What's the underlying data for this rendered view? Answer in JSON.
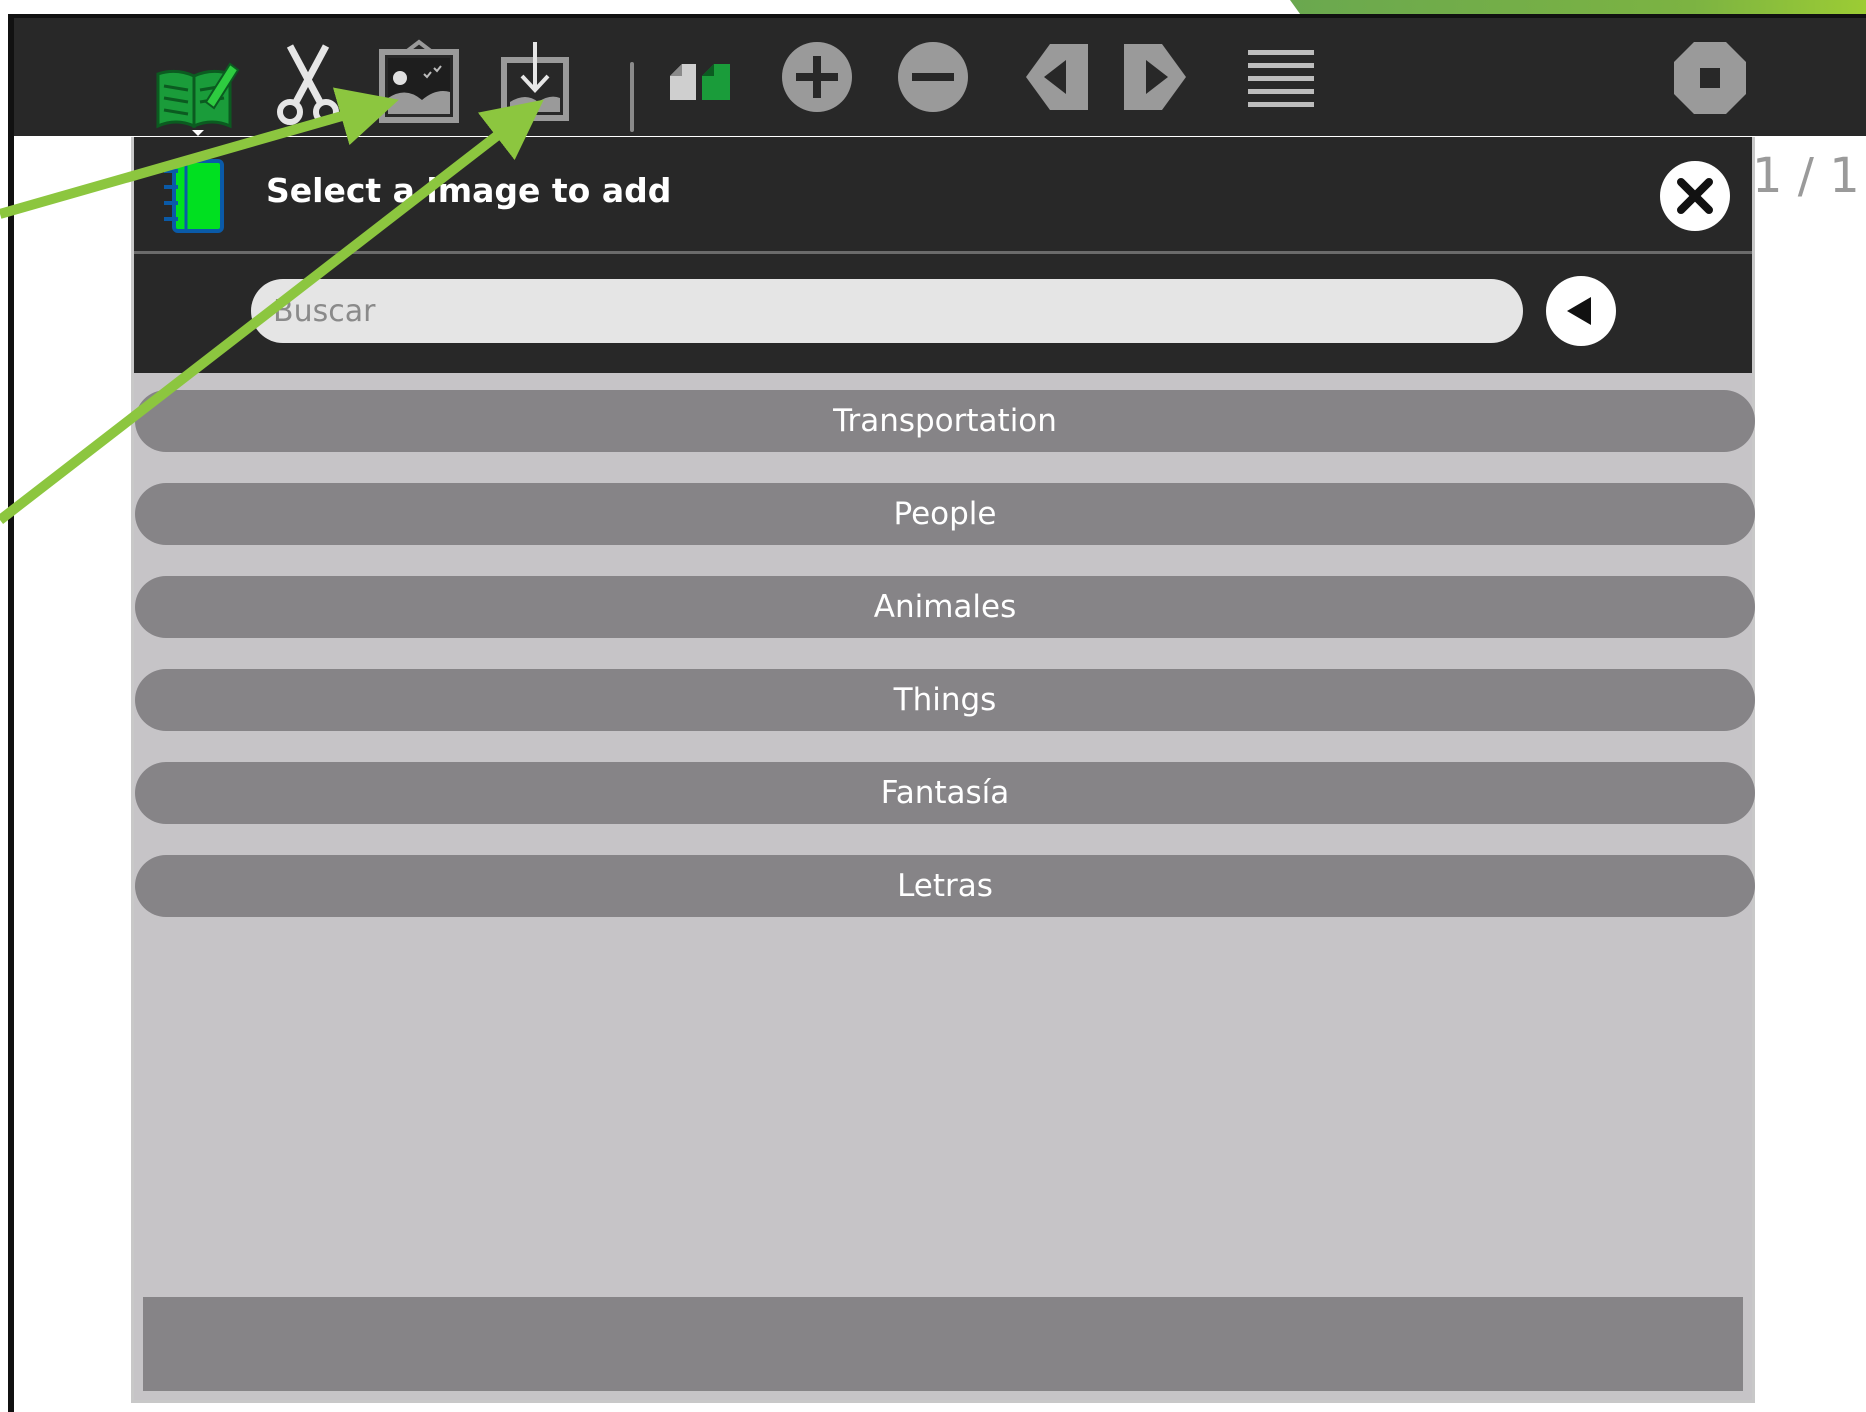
{
  "toolbar": {
    "page_counter": "1 / 1",
    "icons": [
      "activity-icon",
      "cut-icon",
      "add-image-icon",
      "import-image-icon",
      "layout-icon",
      "zoom-in-icon",
      "zoom-out-icon",
      "previous-icon",
      "next-icon",
      "menu-icon",
      "stop-icon"
    ]
  },
  "dialog": {
    "title": "Select a image to add",
    "search": {
      "placeholder": "Buscar",
      "value": ""
    },
    "categories": [
      {
        "label": "Transportation"
      },
      {
        "label": "People"
      },
      {
        "label": "Animales"
      },
      {
        "label": "Things"
      },
      {
        "label": "Fantasía"
      },
      {
        "label": "Letras"
      }
    ]
  },
  "colors": {
    "toolbar_bg": "#282828",
    "dialog_bg": "#c6c4c7",
    "category_bg": "#868487",
    "accent_green": "#8cc63f",
    "icon_green": "#00e020"
  }
}
